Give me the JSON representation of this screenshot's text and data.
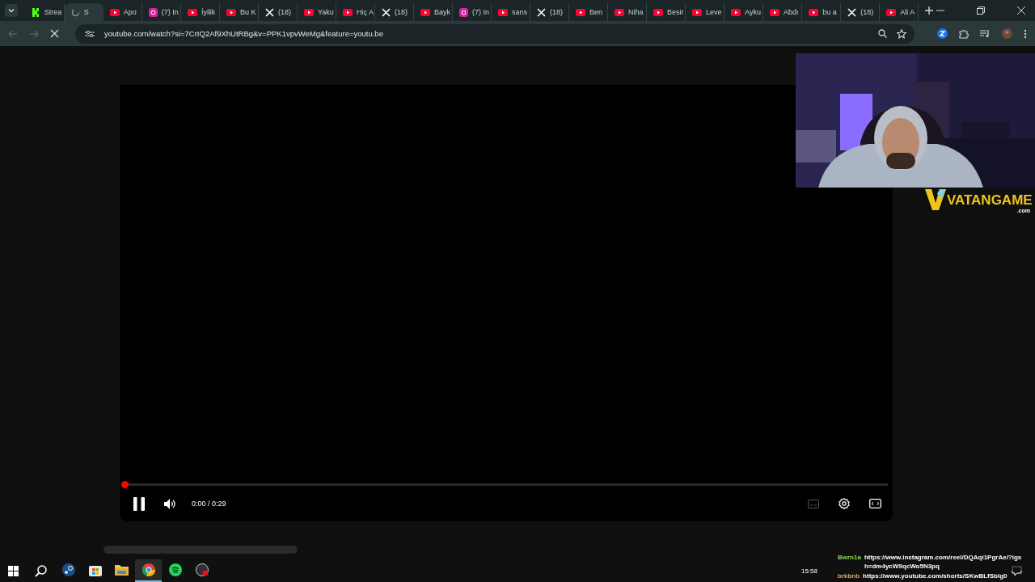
{
  "tabs": [
    {
      "kind": "kick",
      "label": "Strea",
      "selected": false
    },
    {
      "kind": "loading",
      "label": "S",
      "selected": true
    },
    {
      "kind": "youtube",
      "label": "Apo",
      "selected": false
    },
    {
      "kind": "instagram",
      "label": "(7) In",
      "selected": false
    },
    {
      "kind": "youtube",
      "label": "İyilik",
      "selected": false
    },
    {
      "kind": "youtube",
      "label": "Bu K",
      "selected": false
    },
    {
      "kind": "x",
      "label": "(18)",
      "selected": false
    },
    {
      "kind": "youtube",
      "label": "Yaku",
      "selected": false
    },
    {
      "kind": "youtube",
      "label": "Hiç A",
      "selected": false
    },
    {
      "kind": "x",
      "label": "(18)",
      "selected": false
    },
    {
      "kind": "youtube",
      "label": "Bayk",
      "selected": false
    },
    {
      "kind": "instagram",
      "label": "(7) In",
      "selected": false
    },
    {
      "kind": "youtube",
      "label": "sans",
      "selected": false
    },
    {
      "kind": "x",
      "label": "(18)",
      "selected": false
    },
    {
      "kind": "youtube",
      "label": "Ben",
      "selected": false
    },
    {
      "kind": "youtube",
      "label": "Niha",
      "selected": false
    },
    {
      "kind": "youtube",
      "label": "Besir",
      "selected": false
    },
    {
      "kind": "youtube",
      "label": "Leve",
      "selected": false
    },
    {
      "kind": "youtube",
      "label": "Ayku",
      "selected": false
    },
    {
      "kind": "youtube",
      "label": "Abdı",
      "selected": false
    },
    {
      "kind": "youtube",
      "label": "bu a",
      "selected": false
    },
    {
      "kind": "x",
      "label": "(18)",
      "selected": false
    },
    {
      "kind": "youtube",
      "label": "Ali A",
      "selected": false
    }
  ],
  "address_bar": {
    "url": "youtube.com/watch?si=7CrIQ2Af9XhUtRBg&v=PPK1vpvWeMg&feature=youtu.be",
    "loading": true
  },
  "player": {
    "playing": true,
    "level": 0.0,
    "time": "0:00 / 0:29"
  },
  "overlay": {
    "logo": "VATANGAME",
    "logo_suffix": ".com"
  },
  "chat": [
    {
      "user": "Bwrn1a",
      "color": "#8fd64a",
      "message": "https://www.instagram.com/reel/DQAqi1PgrAe/?igsh=dm4ycW9qcWo5N3pq"
    },
    {
      "user": "brkbnb",
      "color": "#d8a86a",
      "message": "https://www.youtube.com/shorts/SKwBLfSblg0"
    }
  ],
  "taskbar": {
    "apps": [
      {
        "kind": "steam",
        "selected": false
      },
      {
        "kind": "store",
        "selected": false
      },
      {
        "kind": "files",
        "selected": false
      },
      {
        "kind": "chrome",
        "selected": true
      },
      {
        "kind": "spotify",
        "selected": false
      },
      {
        "kind": "obs",
        "selected": false
      }
    ],
    "clock": "15:58"
  }
}
